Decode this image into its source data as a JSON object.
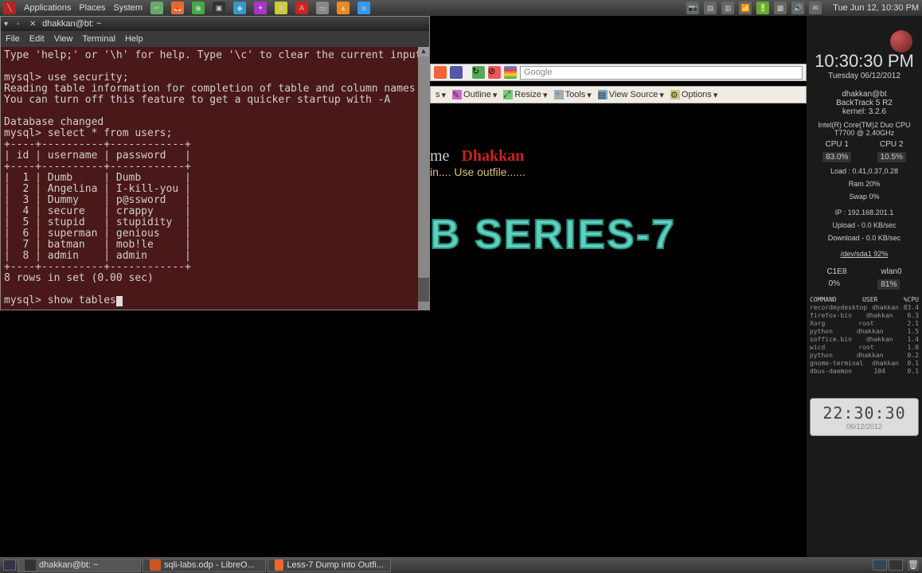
{
  "top_panel": {
    "menus": {
      "applications": "Applications",
      "places": "Places",
      "system": "System"
    },
    "clock": "Tue Jun 12, 10:30 PM"
  },
  "terminal": {
    "title": "dhakkan@bt: ~",
    "menus": {
      "file": "File",
      "edit": "Edit",
      "view": "View",
      "terminal": "Terminal",
      "help": "Help"
    },
    "help_line": "Type 'help;' or '\\h' for help. Type '\\c' to clear the current input statement.",
    "use_db": "mysql> use security;",
    "read_info1": "Reading table information for completion of table and column names",
    "read_info2": "You can turn off this feature to get a quicker startup with -A",
    "db_changed": "Database changed",
    "select_q": "mysql> select * from users;",
    "sep": "+----+----------+------------+",
    "header_row": "| id | username | password   |",
    "rows": [
      "|  1 | Dumb     | Dumb       |",
      "|  2 | Angelina | I-kill-you |",
      "|  3 | Dummy    | p@ssword   |",
      "|  4 | secure   | crappy     |",
      "|  5 | stupid   | stupidity  |",
      "|  6 | superman | genious    |",
      "|  7 | batman   | mob!le     |",
      "|  8 | admin    | admin      |"
    ],
    "rowcount": "8 rows in set (0.00 sec)",
    "prompt": "mysql> show tables"
  },
  "browser": {
    "search_placeholder": "Google",
    "toolbar2": {
      "s": "s",
      "outline": "Outline",
      "resize": "Resize",
      "tools": "Tools",
      "viewsource": "View Source",
      "options": "Options"
    }
  },
  "page": {
    "welcome_me": "me",
    "welcome_name": "Dhakkan",
    "subtitle_in": " in....",
    "subtitle_rest": " Use outfile......",
    "logo": "B SERIES-7"
  },
  "conky": {
    "time": "10:30:30 PM",
    "date": "Tuesday 06/12/2012",
    "host": "dhakkan@bt",
    "distro": "BackTrack 5 R2",
    "kernel": "kernel: 3.2.6",
    "cpu_model": "Intel(R) Core(TM)2 Duo CPU\nT7700  @ 2.40GHz",
    "cpu1_label": "CPU 1",
    "cpu2_label": "CPU 2",
    "cpu1": "83.0%",
    "cpu2": "10.5%",
    "load": "Load : 0.41,0.37,0.28",
    "ram": "Ram 20%",
    "swap": "Swap 0%",
    "ip": "IP : 192.168.201.1",
    "upload": "Upload - 0.0 KB/sec",
    "download": "Download - 0.0 KB/sec",
    "disk": "/dev/sda1 92%",
    "iface1": "C1E8",
    "iface2": "wlan0",
    "iface1_pct": "0%",
    "iface2_pct": "81%",
    "proc_head": {
      "cmd": "COMMAND",
      "user": "USER",
      "cpu": "%CPU"
    },
    "procs": [
      {
        "cmd": "recordmydesktop",
        "user": "dhakkan",
        "cpu": "83.4"
      },
      {
        "cmd": "firefox-bin",
        "user": "dhakkan",
        "cpu": "6.3"
      },
      {
        "cmd": "Xorg",
        "user": "root",
        "cpu": "2.1"
      },
      {
        "cmd": "python",
        "user": "dhakkan",
        "cpu": "1.5"
      },
      {
        "cmd": "soffice.bin",
        "user": "dhakkan",
        "cpu": "1.4"
      },
      {
        "cmd": "wicd",
        "user": "root",
        "cpu": "1.0"
      },
      {
        "cmd": "python",
        "user": "dhakkan",
        "cpu": "0.2"
      },
      {
        "cmd": "gnome-terminal",
        "user": "dhakkan",
        "cpu": "0.1"
      },
      {
        "cmd": "dbus-daemon",
        "user": "104",
        "cpu": "0.1"
      }
    ],
    "clock_big": "22:30:30",
    "clock_date": "06/12/2012"
  },
  "taskbar": {
    "items": [
      "dhakkan@bt: ~",
      "sqli-labs.odp - LibreO...",
      "Less-7 Dump into Outfi..."
    ]
  }
}
